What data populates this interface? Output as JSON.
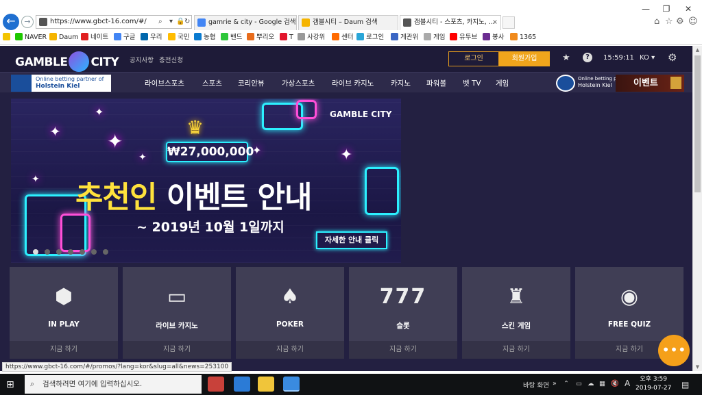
{
  "browser": {
    "url": "https://www.gbct-16.com/#/",
    "tabs": [
      {
        "label": "gamrie & city - Google 검색"
      },
      {
        "label": "갬블시티 – Daum 검색"
      },
      {
        "label": "갬블시티 - 스포츠, 카지노, ..."
      }
    ],
    "favorites": [
      "NAVER",
      "Daum",
      "네이트",
      "구글",
      "우리",
      "국민",
      "농협",
      "밴드",
      "뿌리오",
      "T",
      "사강위",
      "센터",
      "로그인",
      "게관위",
      "게임",
      "유투브",
      "봉사",
      "1365"
    ]
  },
  "site": {
    "logo": "GAMBLE",
    "logo2": "CITY",
    "top_links": [
      "공지사항",
      "충전신청"
    ],
    "login_label": "로그인",
    "join_label": "회원가입",
    "time": "15:59:11",
    "lang": "KO",
    "partner_line1": "Online betting partner of",
    "partner_line2": "Holstein Kiel",
    "partner_small1": "Online betting partner of",
    "partner_small2": "Holstein Kiel",
    "event_label": "이벤트",
    "menu": [
      "라이브스포츠",
      "스포츠",
      "코리안뷰",
      "가상스포츠",
      "라이브 카지노",
      "카지노",
      "파워볼",
      "벳 TV",
      "게임"
    ]
  },
  "banner": {
    "brand": "GAMBLE CITY",
    "prize": "₩27,000,000",
    "headline_a": "추천인",
    "headline_b": " 이벤트 안내",
    "date": "~ 2019년 10월 1일까지",
    "cta": "자세한 안내 클릭",
    "slides": 7,
    "active_slide": 1
  },
  "tiles": [
    {
      "icon": "chip-icon",
      "label": "IN PLAY",
      "play": "지금 하기"
    },
    {
      "icon": "live-casino-icon",
      "label": "라이브 카지노",
      "play": "지금 하기"
    },
    {
      "icon": "cards-icon",
      "label": "POKER",
      "play": "지금 하기"
    },
    {
      "icon": "slot-777-icon",
      "label": "슬롯",
      "play": "지금 하기"
    },
    {
      "icon": "chess-rook-icon",
      "label": "스킨 게임",
      "play": "지금 하기"
    },
    {
      "icon": "quiz-icon",
      "label": "FREE QUIZ",
      "play": "지금 하기"
    }
  ],
  "status_url": "https://www.gbct-16.com/#/promos/?lang=kor&slug=all&news=253100",
  "taskbar": {
    "search_placeholder": "검색하려면 여기에 입력하십시오.",
    "desktop_label": "바탕 화면",
    "ime": "A",
    "time": "오후 3:59",
    "date": "2019-07-27"
  }
}
